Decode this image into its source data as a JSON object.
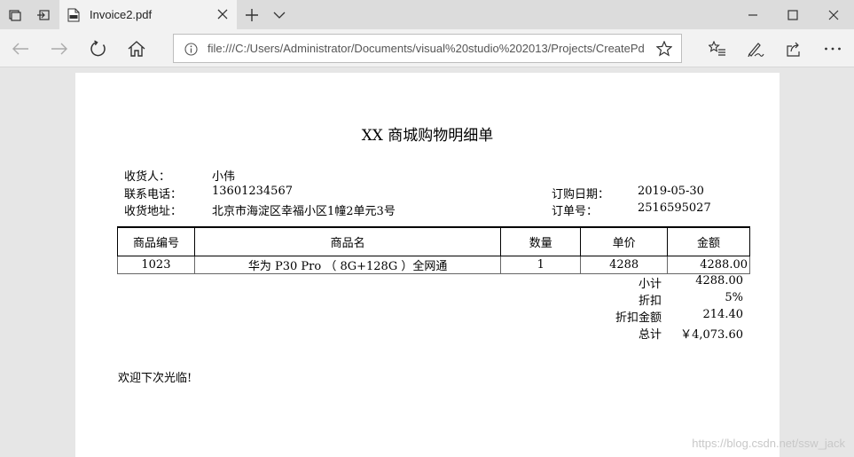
{
  "browser": {
    "tab": {
      "title": "Invoice2.pdf"
    },
    "address": {
      "url": "file:///C:/Users/Administrator/Documents/visual%20studio%202013/Projects/CreatePd"
    }
  },
  "invoice": {
    "title": "XX 商城购物明细单",
    "recipient_label": "收货人：",
    "recipient_value": "小伟",
    "phone_label": "联系电话：",
    "phone_value": "13601234567",
    "address_label": "收货地址：",
    "address_value": "北京市海淀区幸福小区1幢2单元3号",
    "order_date_label": "订购日期：",
    "order_date_value": "2019-05-30",
    "order_no_label": "订单号：",
    "order_no_value": "2516595027",
    "columns": [
      "商品编号",
      "商品名",
      "数量",
      "单价",
      "金额"
    ],
    "rows": [
      {
        "code": "1023",
        "name": "华为 P30 Pro （ 8G+128G ）全网通",
        "qty": "1",
        "price": "4288",
        "amount": "4288.00"
      }
    ],
    "summary": [
      {
        "label": "小计",
        "value": "4288.00"
      },
      {
        "label": "折扣",
        "value": "5%"
      },
      {
        "label": "折扣金额",
        "value": "214.40"
      },
      {
        "label": "总计",
        "value": "￥4,073.60"
      }
    ],
    "farewell": "欢迎下次光临!"
  },
  "watermark": "https://blog.csdn.net/ssw_jack"
}
